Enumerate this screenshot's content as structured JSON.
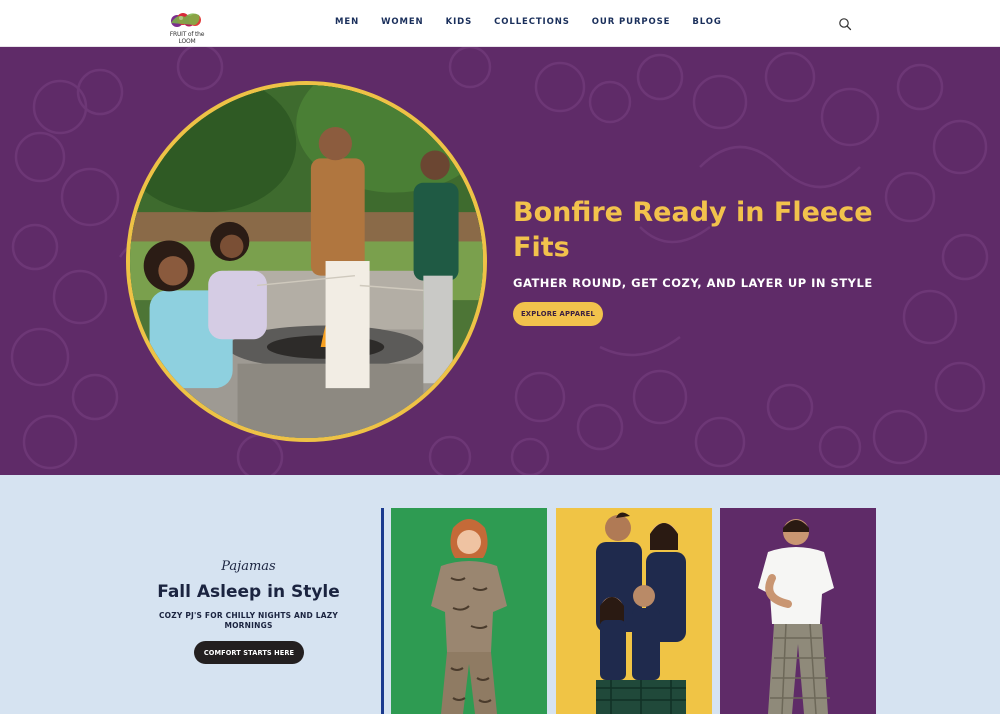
{
  "brand": {
    "logo_alt": "Fruit of the Loom",
    "logo_text": "FRUIT of the LOOM"
  },
  "nav": {
    "items": [
      {
        "label": "MEN"
      },
      {
        "label": "WOMEN"
      },
      {
        "label": "KIDS"
      },
      {
        "label": "COLLECTIONS"
      },
      {
        "label": "OUR PURPOSE"
      },
      {
        "label": "BLOG"
      }
    ],
    "search_icon": "search-icon"
  },
  "hero": {
    "title": "Bonfire Ready in Fleece Fits",
    "subtitle": "GATHER ROUND, GET COZY, AND LAYER UP IN STYLE",
    "cta_label": "EXPLORE APPAREL",
    "image_alt": "Family gathered around a fire pit roasting marshmallows",
    "colors": {
      "background": "#5f2b68",
      "accent": "#f2c24c"
    }
  },
  "pajamas": {
    "eyebrow": "Pajamas",
    "title": "Fall Asleep in Style",
    "description": "COZY PJ'S FOR CHILLY NIGHTS AND LAZY MORNINGS",
    "cta_label": "COMFORT STARTS HERE",
    "cards": [
      {
        "alt": "Woman in zebra print pajama set",
        "bg": "#2e9b52"
      },
      {
        "alt": "Family in matching navy and plaid pajamas",
        "bg": "#f0c445"
      },
      {
        "alt": "Man in white tee and plaid pajama pants",
        "bg": "#5f2b68"
      }
    ]
  }
}
